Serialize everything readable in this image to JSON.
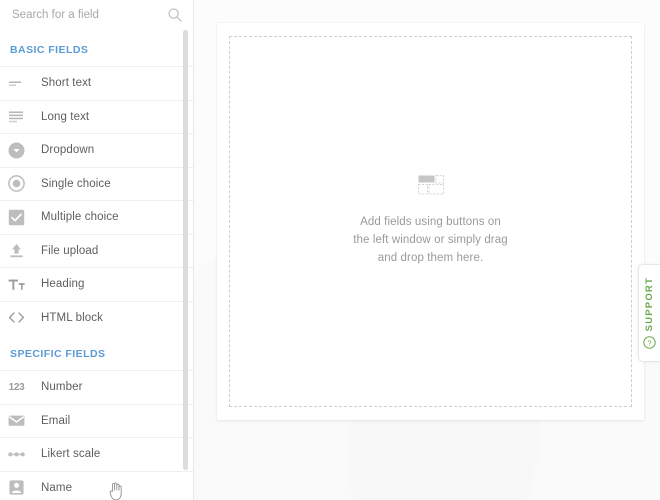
{
  "search": {
    "placeholder": "Search for a field",
    "value": "",
    "icon": "search-icon"
  },
  "sidebar": {
    "sections": [
      {
        "title": "BASIC FIELDS",
        "items": [
          {
            "label": "Short text",
            "icon": "short-text-icon"
          },
          {
            "label": "Long text",
            "icon": "long-text-icon"
          },
          {
            "label": "Dropdown",
            "icon": "dropdown-icon"
          },
          {
            "label": "Single choice",
            "icon": "radio-button-icon"
          },
          {
            "label": "Multiple choice",
            "icon": "checkbox-icon"
          },
          {
            "label": "File upload",
            "icon": "upload-icon"
          },
          {
            "label": "Heading",
            "icon": "heading-icon",
            "glyph": "Tт"
          },
          {
            "label": "HTML block",
            "icon": "code-brackets-icon",
            "glyph": "<>"
          }
        ]
      },
      {
        "title": "SPECIFIC FIELDS",
        "items": [
          {
            "label": "Number",
            "icon": "number-icon",
            "glyph": "123"
          },
          {
            "label": "Email",
            "icon": "envelope-icon"
          },
          {
            "label": "Likert scale",
            "icon": "likert-dots-icon"
          },
          {
            "label": "Name",
            "icon": "person-icon"
          }
        ]
      }
    ]
  },
  "canvas": {
    "dropzone": {
      "icon": "drag-drop-placeholder-icon",
      "message": "Add fields using buttons on the left window or simply drag and drop them here."
    }
  },
  "support": {
    "label": "SUPPORT",
    "icon": "question-circle-icon",
    "color": "#6aa84f"
  },
  "colors": {
    "section_header": "#5b9bd5",
    "field_label": "#5e5e5e",
    "placeholder": "#a8a8a8",
    "dropzone_text": "#9a9a9a",
    "support_green": "#6aa84f",
    "divider": "#eeeeee"
  },
  "cursor": {
    "type": "pointer-hand-cursor"
  }
}
